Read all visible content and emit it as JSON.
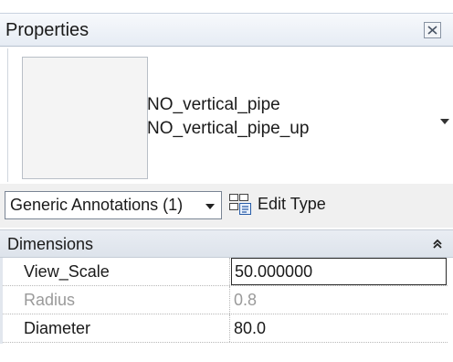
{
  "panel": {
    "title": "Properties",
    "close_icon": "close-icon"
  },
  "type_selector": {
    "family_name": "NO_vertical_pipe",
    "type_name": "NO_vertical_pipe_up",
    "dropdown_icon": "chevron-down-icon"
  },
  "filter": {
    "category_selected": "Generic Annotations (1)",
    "edit_type_label": "Edit Type",
    "edit_type_icon": "edit-type-icon"
  },
  "properties": {
    "group_label": "Dimensions",
    "collapse_icon": "double-chevron-up-icon",
    "rows": [
      {
        "name": "View_Scale",
        "value": "50.000000",
        "editable": true
      },
      {
        "name": "Radius",
        "value": "0.8",
        "editable": false
      },
      {
        "name": "Diameter",
        "value": "80.0",
        "editable": true
      }
    ]
  }
}
